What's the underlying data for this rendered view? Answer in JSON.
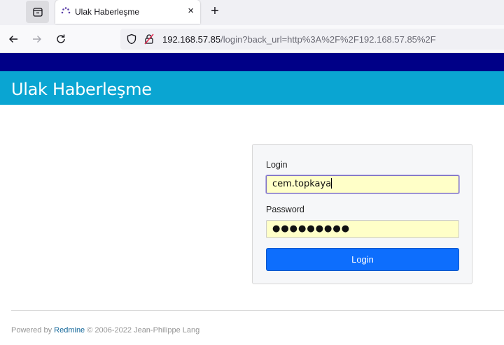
{
  "browser": {
    "tab_title": "Ulak Haberleşme",
    "tab_close_glyph": "×",
    "new_tab_glyph": "+",
    "url_host": "192.168.57.85",
    "url_path": "/login?back_url=http%3A%2F%2F192.168.57.85%2F"
  },
  "page": {
    "site_title": "Ulak Haberleşme"
  },
  "login_form": {
    "login_label": "Login",
    "login_value": "cem.topkaya",
    "password_label": "Password",
    "password_masked": "●●●●●●●●●",
    "submit_label": "Login"
  },
  "footer": {
    "powered_by": "Powered by",
    "redmine": "Redmine",
    "copyright": "© 2006-2022 Jean-Philippe Lang"
  },
  "colors": {
    "topbar": "#000087",
    "header": "#0aa5d2",
    "field_background": "#ffffc8",
    "login_button": "#0d6efd"
  }
}
